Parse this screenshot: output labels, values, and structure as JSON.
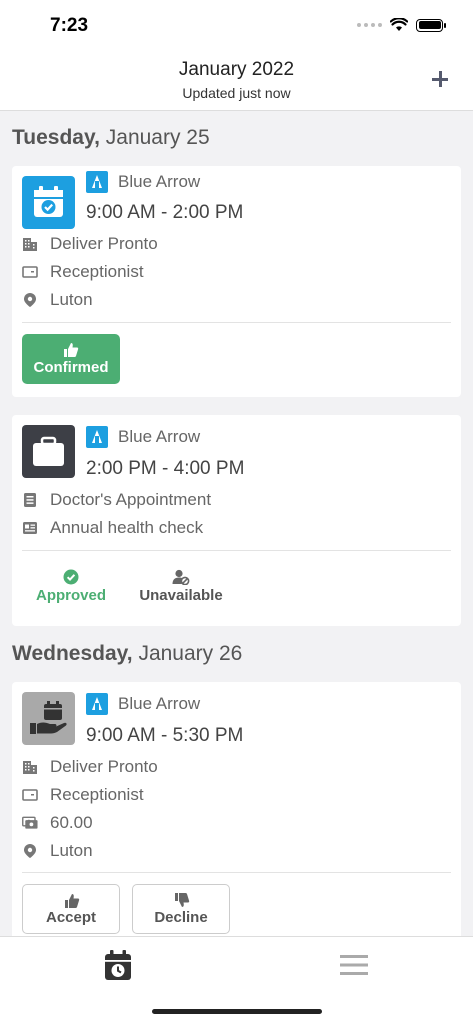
{
  "status_bar": {
    "time": "7:23"
  },
  "header": {
    "title": "January 2022",
    "subtitle": "Updated just now"
  },
  "days": [
    {
      "weekday": "Tuesday,",
      "date": "January 25"
    },
    {
      "weekday": "Wednesday,",
      "date": "January 26"
    }
  ],
  "shifts": [
    {
      "company": "Blue Arrow",
      "time": "9:00 AM - 2:00 PM",
      "client": "Deliver Pronto",
      "role": "Receptionist",
      "location": "Luton",
      "status_label": "Confirmed"
    },
    {
      "company": "Blue Arrow",
      "time": "2:00 PM - 4:00 PM",
      "reason": "Doctor's Appointment",
      "note": "Annual health check",
      "approved_label": "Approved",
      "unavailable_label": "Unavailable"
    },
    {
      "company": "Blue Arrow",
      "time": "9:00 AM - 5:30 PM",
      "client": "Deliver Pronto",
      "role": "Receptionist",
      "pay": "60.00",
      "location": "Luton",
      "accept_label": "Accept",
      "decline_label": "Decline"
    }
  ],
  "colors": {
    "accent_blue": "#1d9fe0",
    "confirmed_green": "#4cae73",
    "dark_icon": "#3d3f46"
  },
  "tabbar": {
    "items": [
      "calendar-clock-icon",
      "menu-icon"
    ]
  }
}
